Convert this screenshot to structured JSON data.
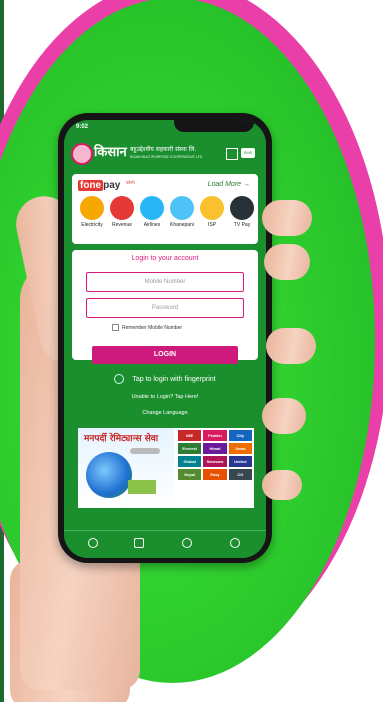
{
  "status_bar": {
    "time": "9:02",
    "icons": "wifi signal battery"
  },
  "header": {
    "bank_name": "किसान",
    "bank_name_small": "बहुउद्देश्यीय सहकारी संस्था लि.",
    "bank_sub": "KISAN MULTIPURPOSE COOPERATIVE LTD.",
    "sms_label": "SMS"
  },
  "fonepay": {
    "logo": "fone pay",
    "tag": "फोनपे",
    "load_more": "Load More →",
    "services": [
      {
        "label": "Electricity",
        "color": "#f7a800"
      },
      {
        "label": "Revenue",
        "color": "#e53935"
      },
      {
        "label": "Airlines",
        "color": "#29b6f6"
      },
      {
        "label": "Khanepani",
        "color": "#4fc3f7"
      },
      {
        "label": "ISP",
        "color": "#fbc02d"
      },
      {
        "label": "TV Pay",
        "color": "#263238"
      }
    ]
  },
  "login": {
    "title": "Login to your account",
    "mobile_placeholder": "Mobile Number",
    "password_placeholder": "Password",
    "remember": "Remember Mobile Number",
    "button": "LOGIN",
    "fingerprint": "Tap to login with fingerprint",
    "unable": "Unable to Login? Tap Here!",
    "language": "Change Language"
  },
  "remit": {
    "title": "मनपर्दी रेमिट्यान्स सेवा",
    "logos": [
      "IME",
      "Prabhu",
      "City",
      "Everest",
      "Himal",
      "Sewa",
      "Global",
      "Samsara",
      "United",
      "Nepal",
      "Easy",
      "CG"
    ]
  }
}
